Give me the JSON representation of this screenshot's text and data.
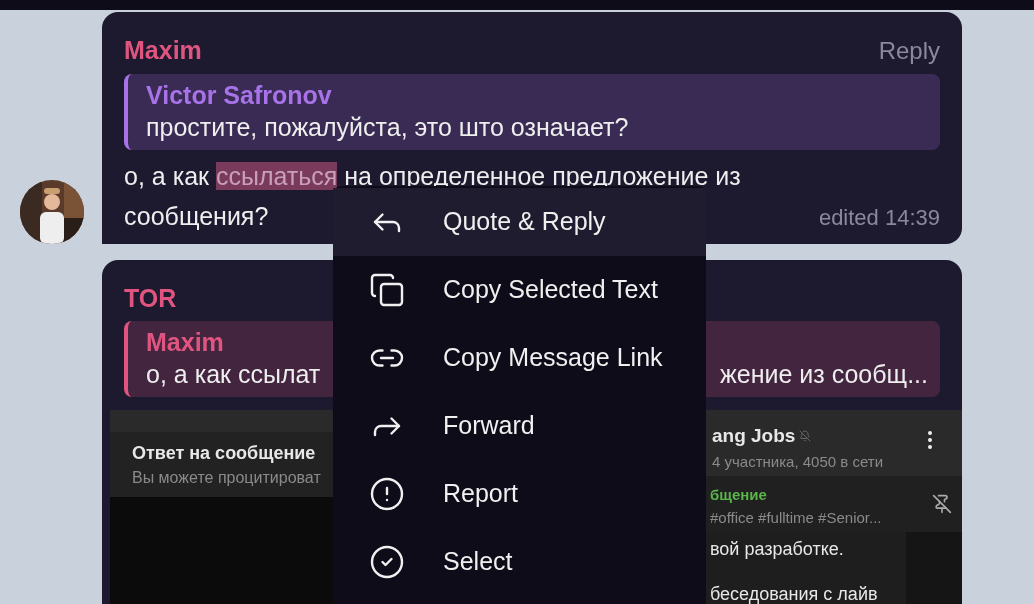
{
  "messages": [
    {
      "sender": "Maxim",
      "color": "#e0557f",
      "action": "Reply",
      "quote": {
        "author": "Victor Safronov",
        "color": "#a873e8",
        "text": "простите, пожалуйста, это што означает?"
      },
      "text": {
        "before": "о, а как ",
        "selected": "ссылаться",
        "after": " на определенное предложение из сообщения?"
      },
      "meta": "edited 14:39",
      "avatar": true
    },
    {
      "sender": "TOR",
      "color": "#e0557f",
      "quote": {
        "author": "Maxim",
        "color": "#e0557f",
        "text_start": "о, а как ссылат",
        "text_end": "жение из сообщ..."
      },
      "screenshot": {
        "left_title": "Ответ на сообщение",
        "left_subtitle": "Вы можете процитироват",
        "chat_title": "ang Jobs",
        "chat_subtitle": "4 участника, 4050 в сети",
        "pinned_label": "бщение",
        "pinned_text": "#office #fulltime #Senior...",
        "lines": [
          "вой разработке.",
          "беседования с лайв"
        ]
      }
    }
  ],
  "context_menu": [
    {
      "kind": "reply",
      "label": "Quote & Reply",
      "selected": true
    },
    {
      "kind": "copy",
      "label": "Copy Selected Text",
      "selected": false
    },
    {
      "kind": "link",
      "label": "Copy Message Link",
      "selected": false
    },
    {
      "kind": "forward",
      "label": "Forward",
      "selected": false
    },
    {
      "kind": "report",
      "label": "Report",
      "selected": false
    },
    {
      "kind": "select",
      "label": "Select",
      "selected": false
    }
  ]
}
